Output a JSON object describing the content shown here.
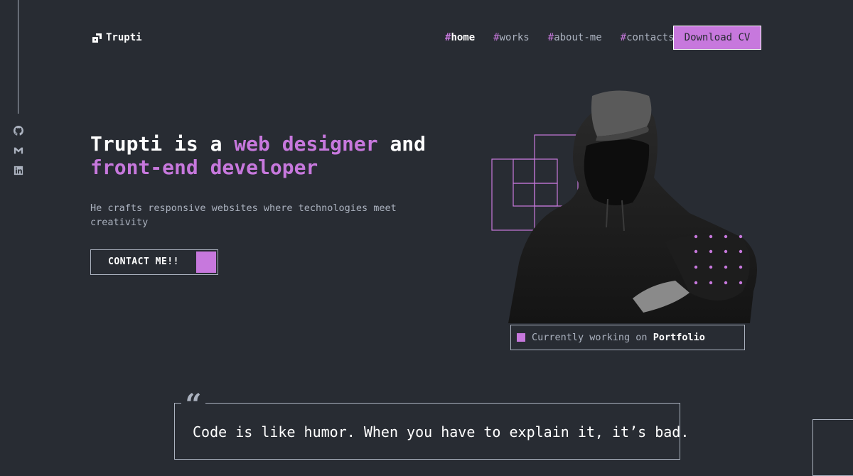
{
  "brand": {
    "name": "Trupti"
  },
  "nav": {
    "items": [
      {
        "hash": "#",
        "label": "home"
      },
      {
        "hash": "#",
        "label": "works"
      },
      {
        "hash": "#",
        "label": "about-me"
      },
      {
        "hash": "#",
        "label": "contacts"
      }
    ],
    "active": "home",
    "cv_button": "Download CV"
  },
  "social": [
    {
      "icon": "github-icon"
    },
    {
      "icon": "gmail-icon"
    },
    {
      "icon": "linkedin-icon"
    }
  ],
  "hero": {
    "headline_prefix": "Trupti is a ",
    "headline_accent1": "web designer",
    "headline_mid": " and",
    "headline_accent2": "front-end developer",
    "subtitle": "He crafts responsive websites where technologies meet creativity",
    "contact_button": "CONTACT ME!!"
  },
  "status": {
    "prefix": "Currently working on ",
    "project": "Portfolio"
  },
  "quote": {
    "mark": "“",
    "text": "Code is like humor. When you have to explain it, it’s bad."
  },
  "colors": {
    "accent": "#c778dd",
    "background": "#282c33",
    "text": "#abb2bf",
    "white": "#ffffff"
  }
}
